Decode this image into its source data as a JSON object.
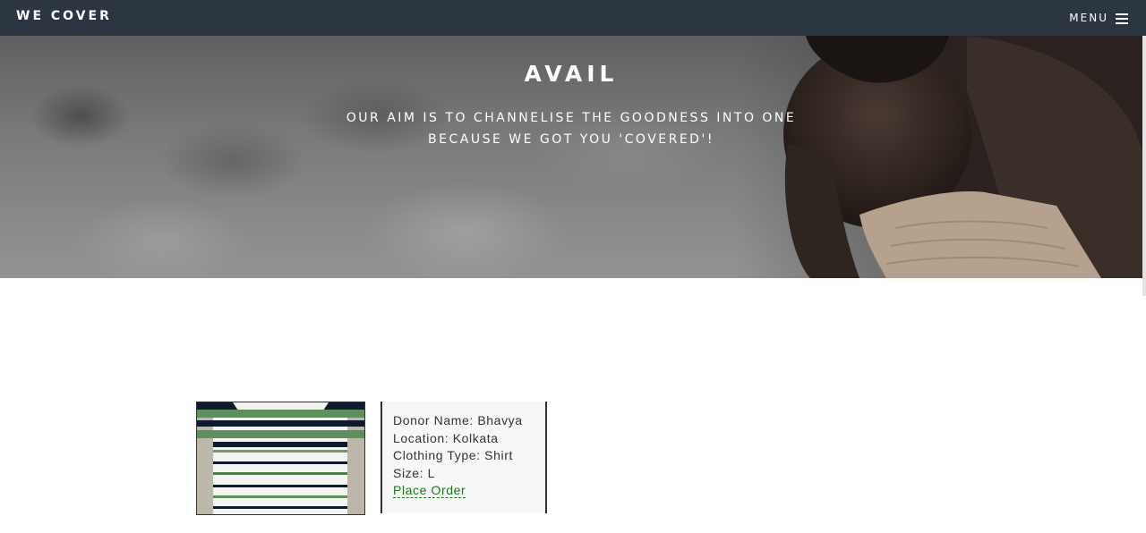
{
  "navbar": {
    "brand": "WE COVER",
    "menu_label": "MENU"
  },
  "hero": {
    "title": "AVAIL",
    "subtitle_line1": "OUR AIM IS TO CHANNELISE THE GOODNESS INTO ONE",
    "subtitle_line2": "BECAUSE WE GOT YOU 'COVERED'!"
  },
  "listing": {
    "donor_label": "Donor Name:",
    "donor_value": "Bhavya",
    "location_label": "Location:",
    "location_value": "Kolkata",
    "clothing_label": "Clothing Type:",
    "clothing_value": "Shirt",
    "size_label": "Size:",
    "size_value": "L",
    "order_label": "Place Order"
  },
  "colors": {
    "navbar_bg": "#2c3640",
    "link_green": "#1a7a1a"
  },
  "icons": {
    "menu": "hamburger-icon"
  }
}
